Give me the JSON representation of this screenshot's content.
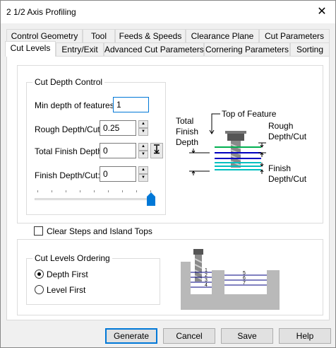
{
  "window": {
    "title": "2 1/2 Axis Profiling",
    "close_icon": "close-icon"
  },
  "tabs_row1": [
    "Control Geometry",
    "Tool",
    "Feeds & Speeds",
    "Clearance Plane",
    "Cut Parameters"
  ],
  "tabs_row2": [
    "Cut Levels",
    "Entry/Exit",
    "Advanced Cut Parameters",
    "Cornering Parameters",
    "Sorting"
  ],
  "active_tab": "Cut Levels",
  "cut_depth": {
    "group_label": "Cut Depth Control",
    "min_depth_label": "Min depth of features:",
    "min_depth_value": "1",
    "rough_label": "Rough Depth/Cut:",
    "rough_value": "0.25",
    "total_finish_label": "Total Finish Depth:",
    "total_finish_value": "0",
    "finish_label": "Finish Depth/Cut:",
    "finish_value": "0",
    "slider_level": 1.0
  },
  "diagram1": {
    "total_finish_depth": "Total Finish Depth",
    "top_of_feature": "Top of Feature",
    "rough_depth_cut": "Rough Depth/Cut",
    "finish_depth_cut": "Finish Depth/Cut"
  },
  "clear_steps": {
    "label": "Clear Steps and Island Tops",
    "checked": false
  },
  "ordering": {
    "group_label": "Cut Levels Ordering",
    "depth_first": "Depth First",
    "level_first": "Level First",
    "selected": "Depth First"
  },
  "diagram2": {
    "left_levels": [
      "1",
      "2",
      "3",
      "4"
    ],
    "right_levels": [
      "5",
      "6",
      "7"
    ]
  },
  "buttons": {
    "generate": "Generate",
    "cancel": "Cancel",
    "save": "Save",
    "help": "Help"
  }
}
